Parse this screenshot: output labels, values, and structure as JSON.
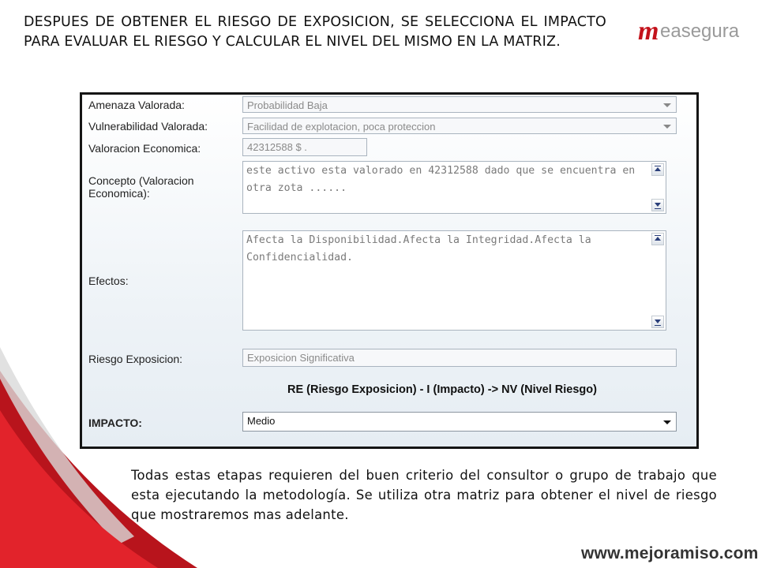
{
  "slide": {
    "heading": "DESPUES    DE    OBTENER EL RIESGO DE EXPOSICION, SE SELECCIONA EL IMPACTO PARA  EVALUAR EL RIESGO Y CALCULAR EL NIVEL DEL MISMO EN LA MATRIZ.",
    "body": "Todas estas etapas requieren del buen criterio del consultor o grupo de trabajo que esta ejecutando la metodología. Se utiliza otra matriz para obtener el nivel de riesgo que mostraremos mas adelante.",
    "website": "www.mejoramiso.com"
  },
  "logo": {
    "mark": "m",
    "text": "easegura",
    "brand_color": "#c3121b"
  },
  "form": {
    "amenaza": {
      "label": "Amenaza Valorada:",
      "value": "Probabilidad Baja"
    },
    "vulnerabilidad": {
      "label": "Vulnerabilidad Valorada:",
      "value": "Facilidad de explotacion, poca proteccion"
    },
    "valoracion": {
      "label": "Valoracion Economica:",
      "value": "42312588 $ ."
    },
    "concepto": {
      "label": "Concepto (Valoracion Economica):",
      "value": "este activo esta valorado en 42312588 dado que se encuentra en otra zota ......"
    },
    "efectos": {
      "label": "Efectos:",
      "value": "Afecta la Disponibilidad.Afecta la Integridad.Afecta la Confidencialidad."
    },
    "riesgo": {
      "label": "Riesgo Exposicion:",
      "value": "Exposicion Significativa"
    },
    "formula": "RE (Riesgo Exposicion) - I (Impacto) -> NV (Nivel Riesgo)",
    "impacto": {
      "label": "IMPACTO:",
      "value": "Medio"
    }
  }
}
